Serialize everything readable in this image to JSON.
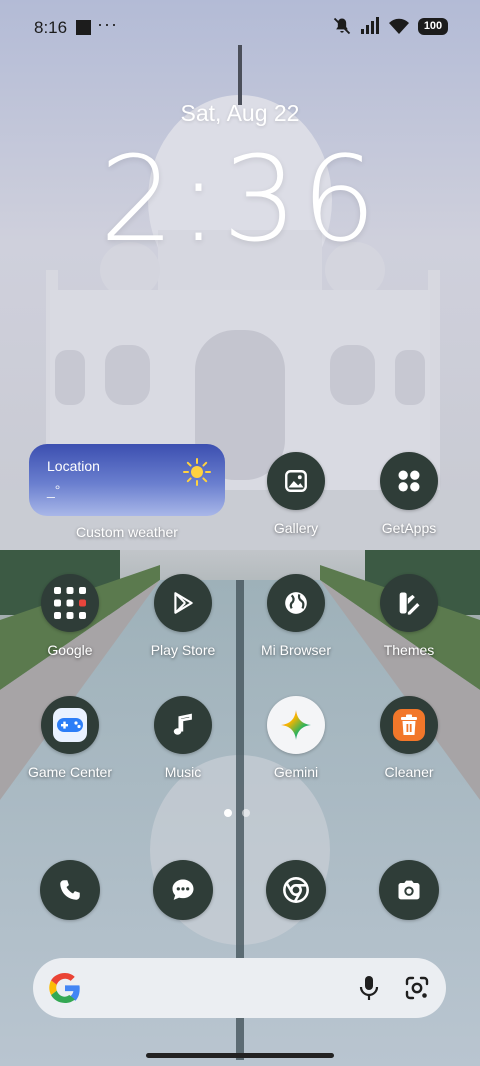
{
  "status_bar": {
    "time": "8:16",
    "dots": "···",
    "battery": "100"
  },
  "lock": {
    "date": "Sat, Aug 22",
    "clock": "2:36"
  },
  "weather_widget": {
    "location": "Location",
    "temperature": "_°",
    "label": "Custom weather"
  },
  "apps": [
    {
      "label": "Gallery",
      "icon": "gallery-icon"
    },
    {
      "label": "GetApps",
      "icon": "getapps-icon"
    },
    {
      "label": "Google",
      "icon": "google-folder-icon"
    },
    {
      "label": "Play Store",
      "icon": "play-store-icon"
    },
    {
      "label": "Mi Browser",
      "icon": "globe-icon"
    },
    {
      "label": "Themes",
      "icon": "themes-icon"
    },
    {
      "label": "Game Center",
      "icon": "gamepad-icon"
    },
    {
      "label": "Music",
      "icon": "music-note-icon"
    },
    {
      "label": "Gemini",
      "icon": "gemini-star-icon"
    },
    {
      "label": "Cleaner",
      "icon": "trash-icon"
    }
  ],
  "dock": [
    {
      "name": "Phone",
      "icon": "phone-icon"
    },
    {
      "name": "Messages",
      "icon": "message-icon"
    },
    {
      "name": "Chrome",
      "icon": "chrome-icon"
    },
    {
      "name": "Camera",
      "icon": "camera-icon"
    }
  ],
  "pager": {
    "pages": 2,
    "current": 1
  },
  "colors": {
    "icon_bg": "#2f3d38",
    "cleaner_orange": "#f2772a",
    "search_bg": "#ebeef2"
  }
}
